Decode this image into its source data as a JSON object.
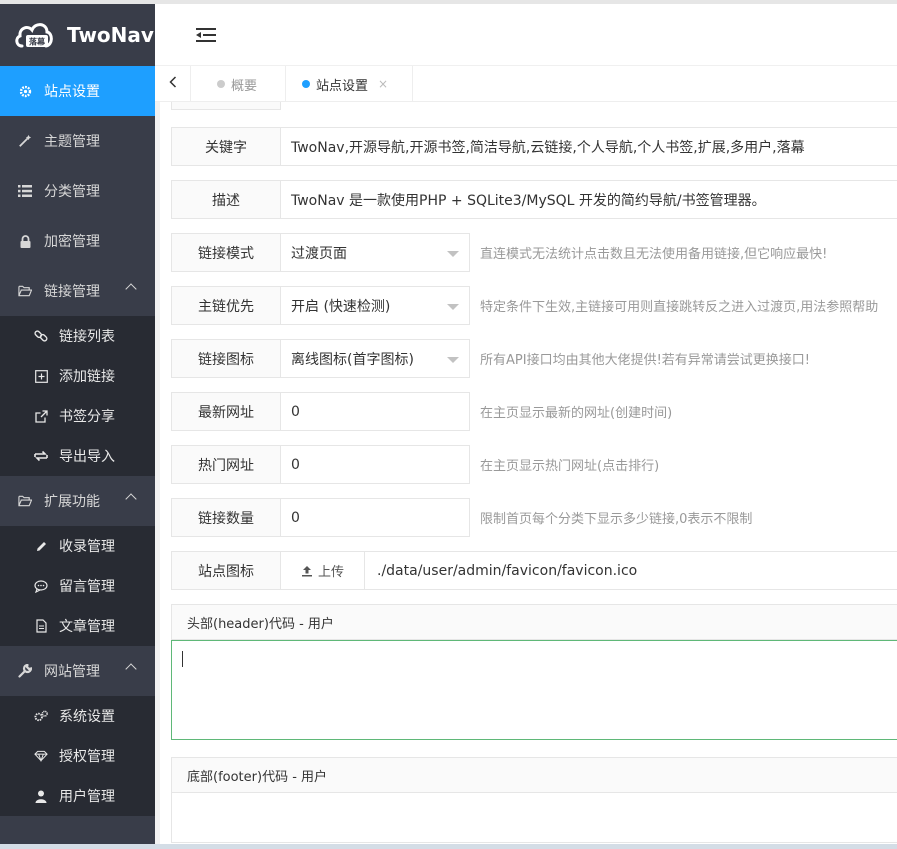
{
  "app": {
    "title": "TwoNav",
    "logo_text": "落幕"
  },
  "sidebar": {
    "items": [
      {
        "label": "站点设置",
        "icon": "gear-icon",
        "active": true
      },
      {
        "label": "主题管理",
        "icon": "magic-wand-icon"
      },
      {
        "label": "分类管理",
        "icon": "list-icon"
      },
      {
        "label": "加密管理",
        "icon": "lock-icon"
      },
      {
        "label": "链接管理",
        "icon": "folder-open-icon",
        "expanded": true,
        "children": [
          {
            "label": "链接列表",
            "icon": "link-icon"
          },
          {
            "label": "添加链接",
            "icon": "plus-square-icon"
          },
          {
            "label": "书签分享",
            "icon": "external-link-icon"
          },
          {
            "label": "导出导入",
            "icon": "exchange-icon"
          }
        ]
      },
      {
        "label": "扩展功能",
        "icon": "folder-open-icon",
        "expanded": true,
        "children": [
          {
            "label": "收录管理",
            "icon": "pencil-icon"
          },
          {
            "label": "留言管理",
            "icon": "comment-icon"
          },
          {
            "label": "文章管理",
            "icon": "document-icon"
          }
        ]
      },
      {
        "label": "网站管理",
        "icon": "wrench-icon",
        "expanded": true,
        "children": [
          {
            "label": "系统设置",
            "icon": "cogs-icon"
          },
          {
            "label": "授权管理",
            "icon": "diamond-icon"
          },
          {
            "label": "用户管理",
            "icon": "user-icon"
          }
        ]
      }
    ]
  },
  "tabs": [
    {
      "label": "概要",
      "active": false
    },
    {
      "label": "站点设置",
      "active": true,
      "close": "×"
    }
  ],
  "form": {
    "keywords": {
      "label": "关键字",
      "value": "TwoNav,开源导航,开源书签,简洁导航,云链接,个人导航,个人书签,扩展,多用户,落幕"
    },
    "description": {
      "label": "描述",
      "value": "TwoNav 是一款使用PHP + SQLite3/MySQL 开发的简约导航/书签管理器。"
    },
    "link_mode": {
      "label": "链接模式",
      "value": "过渡页面",
      "hint": "直连模式无法统计点击数且无法使用备用链接,但它响应最快!"
    },
    "main_link_priority": {
      "label": "主链优先",
      "value": "开启 (快速检测)",
      "hint": "特定条件下生效,主链接可用则直接跳转反之进入过渡页,用法参照帮助"
    },
    "link_icon": {
      "label": "链接图标",
      "value": "离线图标(首字图标)",
      "hint": "所有API接口均由其他大佬提供!若有异常请尝试更换接口!"
    },
    "latest_urls": {
      "label": "最新网址",
      "value": "0",
      "hint": "在主页显示最新的网址(创建时间)"
    },
    "hot_urls": {
      "label": "热门网址",
      "value": "0",
      "hint": "在主页显示热门网址(点击排行)"
    },
    "link_count": {
      "label": "链接数量",
      "value": "0",
      "hint": "限制首页每个分类下显示多少链接,0表示不限制"
    },
    "site_icon": {
      "label": "站点图标",
      "button": "上传",
      "path": "./data/user/admin/favicon/favicon.ico"
    },
    "header_code": {
      "label": "头部(header)代码 - 用户",
      "value": ""
    },
    "footer_code": {
      "label": "底部(footer)代码 - 用户",
      "value": ""
    }
  },
  "colors": {
    "sidebar_bg": "#393d49",
    "active_blue": "#1e9fff",
    "focus_green": "#5fb878"
  }
}
